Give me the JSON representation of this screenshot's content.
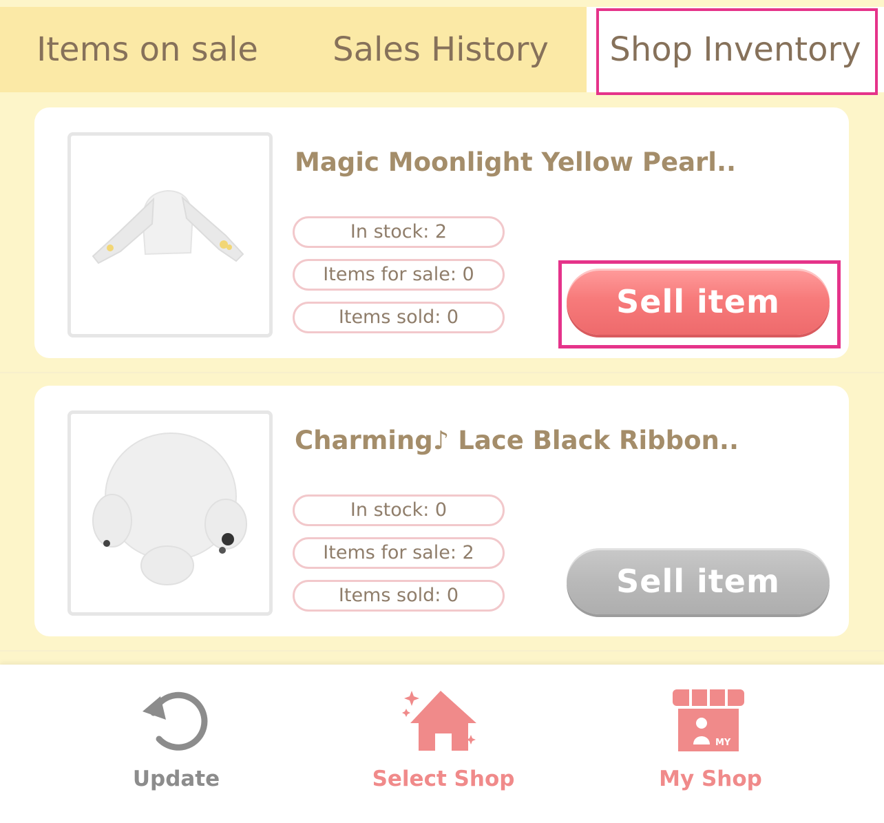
{
  "tabs": [
    {
      "label": "Items on sale"
    },
    {
      "label": "Sales History"
    },
    {
      "label": "Shop Inventory",
      "selected": true
    }
  ],
  "items": [
    {
      "name": "Magic Moonlight Yellow Pearl..",
      "in_stock": "In stock: 2",
      "for_sale": "Items for sale: 0",
      "sold": "Items sold: 0",
      "button": "Sell item",
      "button_enabled": true
    },
    {
      "name": "Charming♪ Lace Black Ribbon..",
      "in_stock": "In stock: 0",
      "for_sale": "Items for sale: 2",
      "sold": "Items sold: 0",
      "button": "Sell item",
      "button_enabled": false
    }
  ],
  "bottom_nav": {
    "update": {
      "label": "Update",
      "icon": "refresh-icon"
    },
    "select_shop": {
      "label": "Select Shop",
      "icon": "house-sparkle-icon"
    },
    "my_shop": {
      "label": "My Shop",
      "icon": "storefront-icon",
      "badge": "MY"
    }
  },
  "colors": {
    "background": "#fdf5c9",
    "tab_inactive": "#fbe9a6",
    "highlight": "#e5338a",
    "accent_pink": "#f08a8a",
    "sell_button": "#f77b7b",
    "disabled": "#b9b9b9"
  }
}
